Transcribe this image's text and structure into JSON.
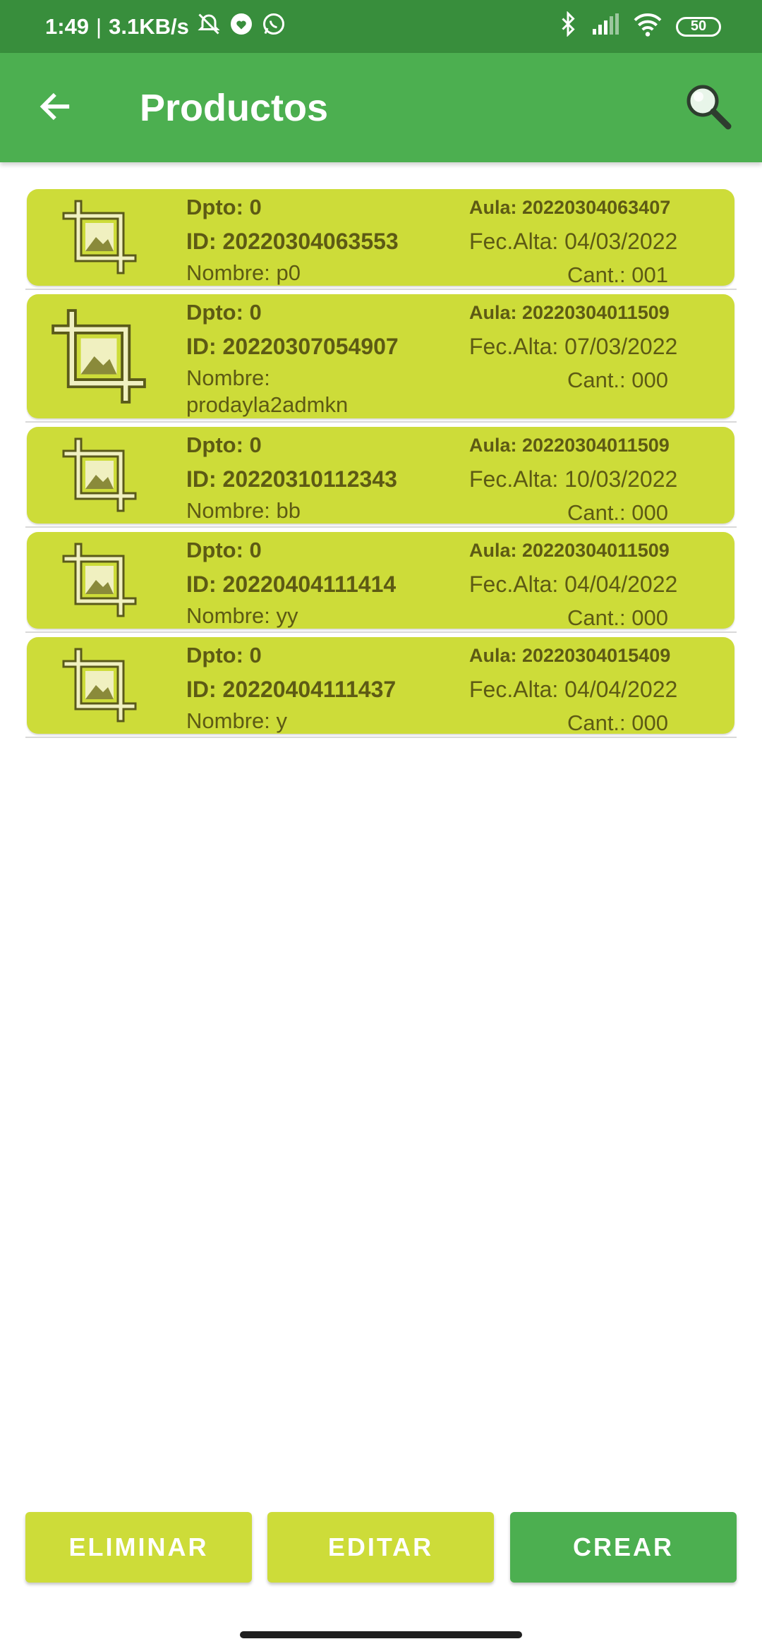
{
  "status_bar": {
    "time": "1:49",
    "separator": "|",
    "speed": "3.1KB/s",
    "battery": "50",
    "icons": [
      "alarm-off-icon",
      "heart-icon",
      "whatsapp-icon",
      "bluetooth-icon",
      "signal-icon",
      "wifi-icon",
      "battery-icon"
    ]
  },
  "app_bar": {
    "title": "Productos",
    "back_icon": "arrow-back-icon",
    "search_icon": "search-icon"
  },
  "products": [
    {
      "dpto": "Dpto: 0",
      "id": "ID: 20220304063553",
      "nombre": "Nombre: p0",
      "aula": "Aula: 20220304063407",
      "fecha": "Fec.Alta: 04/03/2022",
      "cant": "Cant.: 001"
    },
    {
      "dpto": "Dpto: 0",
      "id": "ID: 20220307054907",
      "nombre": "Nombre:",
      "nombre2": "prodayla2admkn",
      "aula": "Aula: 20220304011509",
      "fecha": "Fec.Alta: 07/03/2022",
      "cant": "Cant.: 000"
    },
    {
      "dpto": "Dpto: 0",
      "id": "ID: 20220310112343",
      "nombre": "Nombre: bb",
      "aula": "Aula: 20220304011509",
      "fecha": "Fec.Alta: 10/03/2022",
      "cant": "Cant.: 000"
    },
    {
      "dpto": "Dpto: 0",
      "id": "ID: 20220404111414",
      "nombre": "Nombre: yy",
      "aula": "Aula: 20220304011509",
      "fecha": "Fec.Alta: 04/04/2022",
      "cant": "Cant.: 000"
    },
    {
      "dpto": "Dpto: 0",
      "id": "ID: 20220404111437",
      "nombre": "Nombre: y",
      "aula": "Aula: 20220304015409",
      "fecha": "Fec.Alta: 04/04/2022",
      "cant": "Cant.: 000"
    }
  ],
  "buttons": {
    "eliminar": "ELIMINAR",
    "editar": "EDITAR",
    "crear": "CREAR"
  },
  "colors": {
    "status_bar": "#388e3c",
    "app_bar": "#4caf50",
    "card": "#cddc39",
    "card_text": "#5d5a14",
    "primary_button": "#4caf50",
    "secondary_button": "#cddc39"
  }
}
